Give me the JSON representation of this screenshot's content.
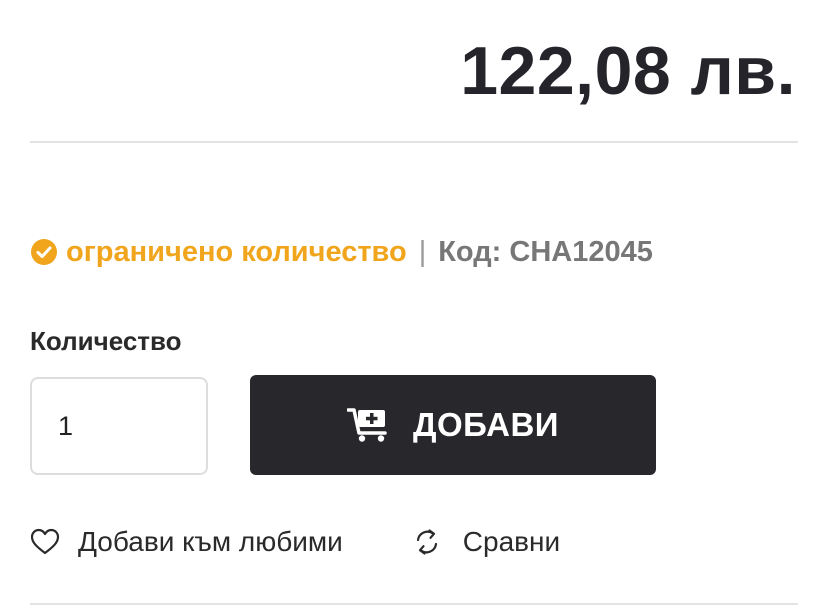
{
  "product": {
    "price": "122,08 лв.",
    "stock_status": "ограничено количество",
    "separator": "|",
    "code": "Код: CHA12045"
  },
  "quantity": {
    "label": "Количество",
    "value": "1"
  },
  "add_button": {
    "label": "ДОБАВИ"
  },
  "actions": {
    "favorites_label": "Добави към любими",
    "compare_label": "Сравни"
  },
  "icons": {
    "stock": "check-circle-icon",
    "add": "cart-plus-icon",
    "favorites": "heart-outline-icon",
    "compare": "refresh-arrows-icon"
  },
  "colors": {
    "accent_stock": "#f0a51c",
    "button_bg": "#27272c",
    "code_text": "#777777",
    "price_text": "#24242a"
  }
}
